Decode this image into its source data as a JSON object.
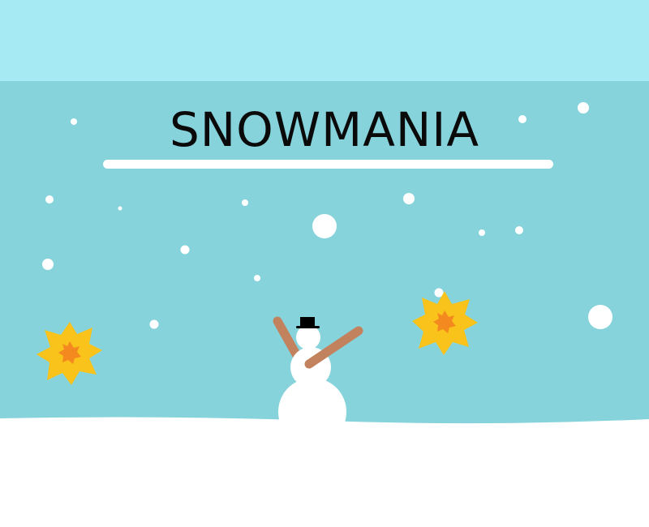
{
  "game": {
    "title": "SNOWMANIA"
  },
  "colors": {
    "sky_top": "#a6eaf3",
    "sky_main": "#86d3dc",
    "snow": "#ffffff",
    "title_text": "#0a0a0a",
    "arm": "#c2825e",
    "hat": "#000000",
    "burst_outer": "#f9c31b",
    "burst_inner": "#f48a1f"
  },
  "icons": {
    "player": "snowman-icon",
    "hazard": "fire-burst-icon",
    "particle": "snowflake-icon"
  }
}
